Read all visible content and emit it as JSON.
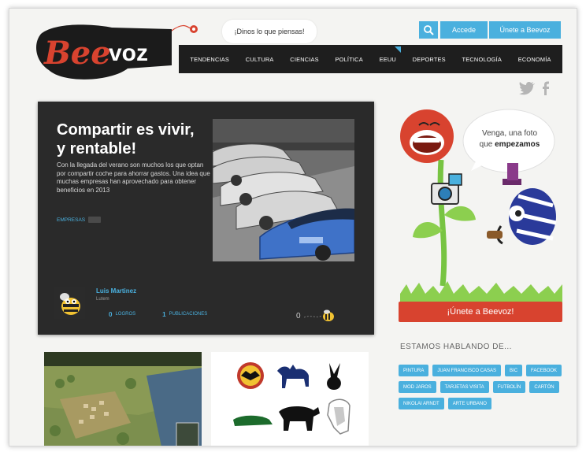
{
  "header": {
    "logo_text": "Beevoz",
    "speech_bubble": "¡Dinos lo que piensas!",
    "login_label": "Accede",
    "join_label": "Únete a Beevoz"
  },
  "nav": {
    "items": [
      "TENDENCIAS",
      "CULTURA",
      "CIENCIAS",
      "POLÍTICA",
      "EEUU",
      "DEPORTES",
      "TECNOLOGÍA",
      "ECONOMÍA"
    ]
  },
  "social": {
    "twitter": "twitter-icon",
    "facebook": "facebook-icon"
  },
  "feature": {
    "title": "Compartir es vivir, y rentable!",
    "description": "Con la llegada del verano son muchos los que optan por compartir coche para ahorrar gastos. Una idea que muchas empresas han aprovechado para obtener beneficios en 2013",
    "tag": "EMPRESAS",
    "author": {
      "name": "Luis Martinez",
      "subtitle": "Lutem",
      "achievements_count": "0",
      "achievements_label": "LOGROS",
      "publications_count": "1",
      "publications_label": "PUBLICACIONES"
    },
    "likes_count": "0"
  },
  "sidebar": {
    "bubble_line1": "Venga, una foto",
    "bubble_line2_prefix": "que ",
    "bubble_line2_bold": "empezamos",
    "join_button": "¡Únete a Beevoz!",
    "talking_title": "ESTAMOS HABLANDO DE...",
    "tags": [
      "PINTURA",
      "JUAN FRANCISCO CASAS",
      "BIC",
      "FACEBOOK",
      "MOD JAROS",
      "TARJETAS VISITA",
      "FUTBOLÍN",
      "CARTÓN",
      "NIKOLAI ARNDT",
      "ARTE URBANO"
    ]
  },
  "colors": {
    "accent": "#4ab0de",
    "brand_red": "#d8432f",
    "nav_bg": "#1e1e1e",
    "card_bg": "#2a2a2a"
  }
}
